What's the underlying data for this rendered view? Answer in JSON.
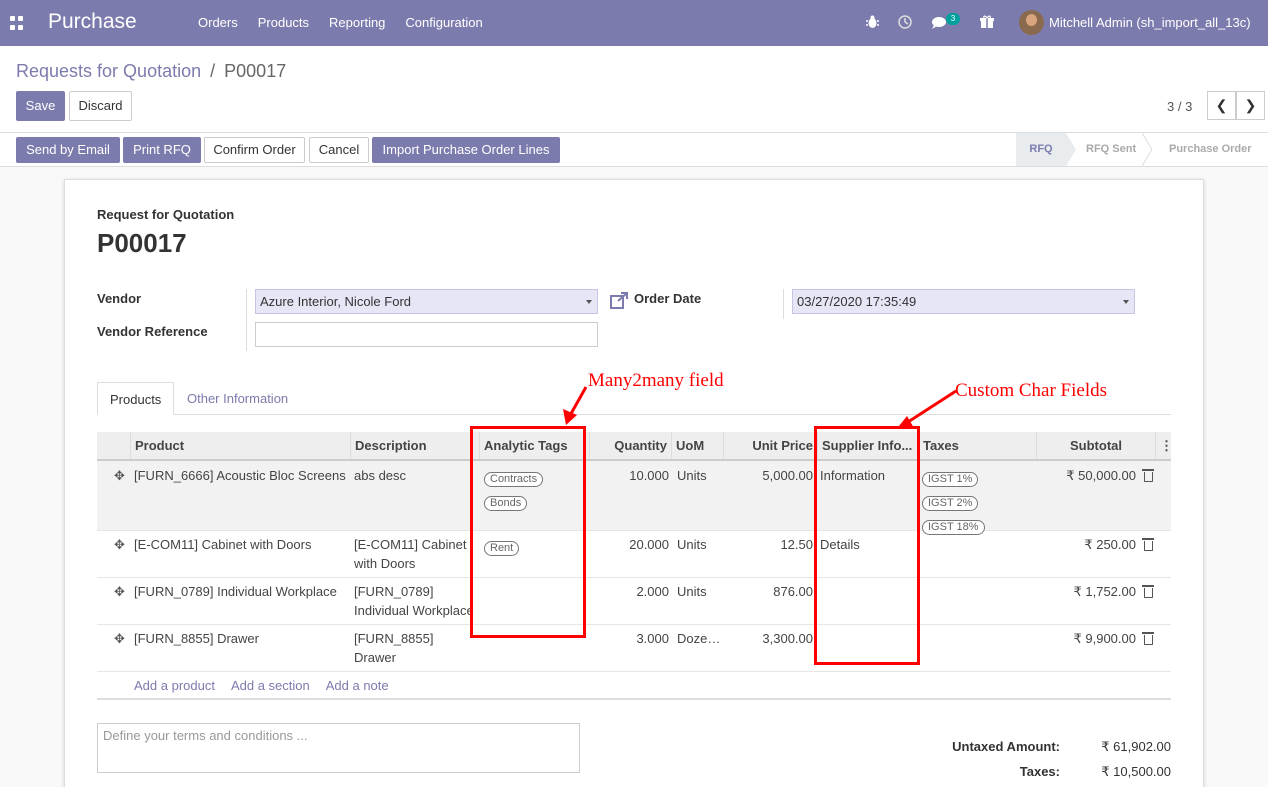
{
  "topbar": {
    "brand": "Purchase",
    "menu": [
      "Orders",
      "Products",
      "Reporting",
      "Configuration"
    ],
    "message_count": "3",
    "user": "Mitchell Admin (sh_import_all_13c)"
  },
  "breadcrumb": {
    "parent": "Requests for Quotation",
    "separator": "/",
    "current": "P00017"
  },
  "buttons": {
    "save": "Save",
    "discard": "Discard"
  },
  "pager": {
    "value": "3 / 3"
  },
  "header_buttons": [
    "Send by Email",
    "Print RFQ",
    "Confirm Order",
    "Cancel",
    "Import Purchase Order Lines"
  ],
  "stages": [
    "RFQ",
    "RFQ Sent",
    "Purchase Order"
  ],
  "form": {
    "doc_type": "Request for Quotation",
    "name": "P00017",
    "vendor_label": "Vendor",
    "vendor": "Azure Interior, Nicole Ford",
    "vendor_ref_label": "Vendor Reference",
    "vendor_ref": "",
    "order_date_label": "Order Date",
    "order_date": "03/27/2020 17:35:49"
  },
  "tabs": [
    "Products",
    "Other Information"
  ],
  "table": {
    "headers": [
      "Product",
      "Description",
      "Analytic Tags",
      "Quantity",
      "UoM",
      "Unit Price",
      "Supplier Info...",
      "Taxes",
      "Subtotal"
    ],
    "rows": [
      {
        "product": "[FURN_6666] Acoustic Bloc Screens",
        "desc": "abs desc",
        "tags": [
          "Contracts",
          "Bonds"
        ],
        "qty": "10.000",
        "uom": "Units",
        "price": "5,000.00",
        "supplier": "Information",
        "taxes": [
          "IGST 1%",
          "IGST 2%",
          "IGST 18%"
        ],
        "subtotal": "₹ 50,000.00"
      },
      {
        "product": "[E-COM11] Cabinet with Doors",
        "desc": "[E-COM11] Cabinet with Doors",
        "tags": [
          "Rent"
        ],
        "qty": "20.000",
        "uom": "Units",
        "price": "12.50",
        "supplier": "Details",
        "taxes": [],
        "subtotal": "₹ 250.00"
      },
      {
        "product": "[FURN_0789] Individual Workplace",
        "desc": "[FURN_0789] Individual Workplace",
        "tags": [],
        "qty": "2.000",
        "uom": "Units",
        "price": "876.00",
        "supplier": "",
        "taxes": [],
        "subtotal": "₹ 1,752.00"
      },
      {
        "product": "[FURN_8855] Drawer",
        "desc": "[FURN_8855] Drawer",
        "tags": [],
        "qty": "3.000",
        "uom": "Doze…",
        "price": "3,300.00",
        "supplier": "",
        "taxes": [],
        "subtotal": "₹ 9,900.00"
      }
    ],
    "add_links": [
      "Add a product",
      "Add a section",
      "Add a note"
    ]
  },
  "terms_placeholder": "Define your terms and conditions ...",
  "totals": {
    "untaxed_label": "Untaxed Amount:",
    "untaxed": "₹ 61,902.00",
    "taxes_label": "Taxes:",
    "taxes": "₹ 10,500.00"
  },
  "annotations": {
    "many2many": "Many2many field",
    "custom": "Custom Char Fields"
  },
  "colors": {
    "brand": "#7c7bad",
    "annotation": "#ff0000"
  }
}
